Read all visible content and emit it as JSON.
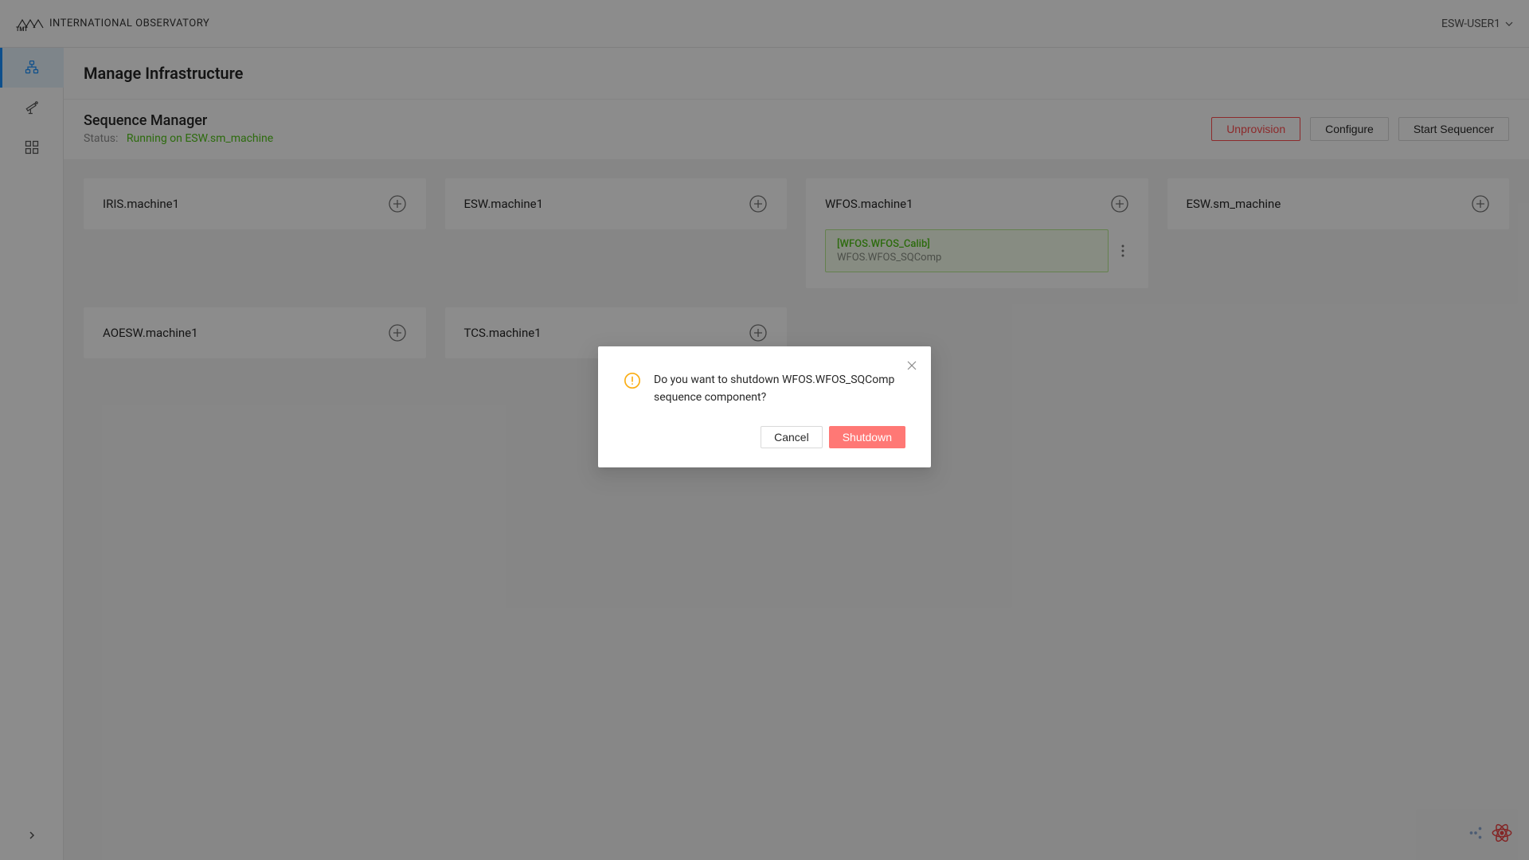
{
  "header": {
    "logo_text": "INTERNATIONAL OBSERVATORY",
    "username": "ESW-USER1"
  },
  "page": {
    "title": "Manage Infrastructure"
  },
  "sequence_manager": {
    "title": "Sequence Manager",
    "status_label": "Status:",
    "status_value": "Running on ESW.sm_machine",
    "buttons": {
      "unprovision": "Unprovision",
      "configure": "Configure",
      "start_sequencer": "Start Sequencer"
    }
  },
  "machines": [
    {
      "name": "IRIS.machine1",
      "has_add": true
    },
    {
      "name": "ESW.machine1",
      "has_add": true
    },
    {
      "name": "WFOS.machine1",
      "has_add": true,
      "component": {
        "label": "[WFOS.WFOS_Calib]",
        "sublabel": "WFOS.WFOS_SQComp"
      }
    },
    {
      "name": "ESW.sm_machine",
      "has_add": true
    },
    {
      "name": "AOESW.machine1",
      "has_add": true
    },
    {
      "name": "TCS.machine1",
      "has_add": true
    }
  ],
  "modal": {
    "message": "Do you want to shutdown WFOS.WFOS_SQComp sequence component?",
    "cancel": "Cancel",
    "confirm": "Shutdown"
  }
}
